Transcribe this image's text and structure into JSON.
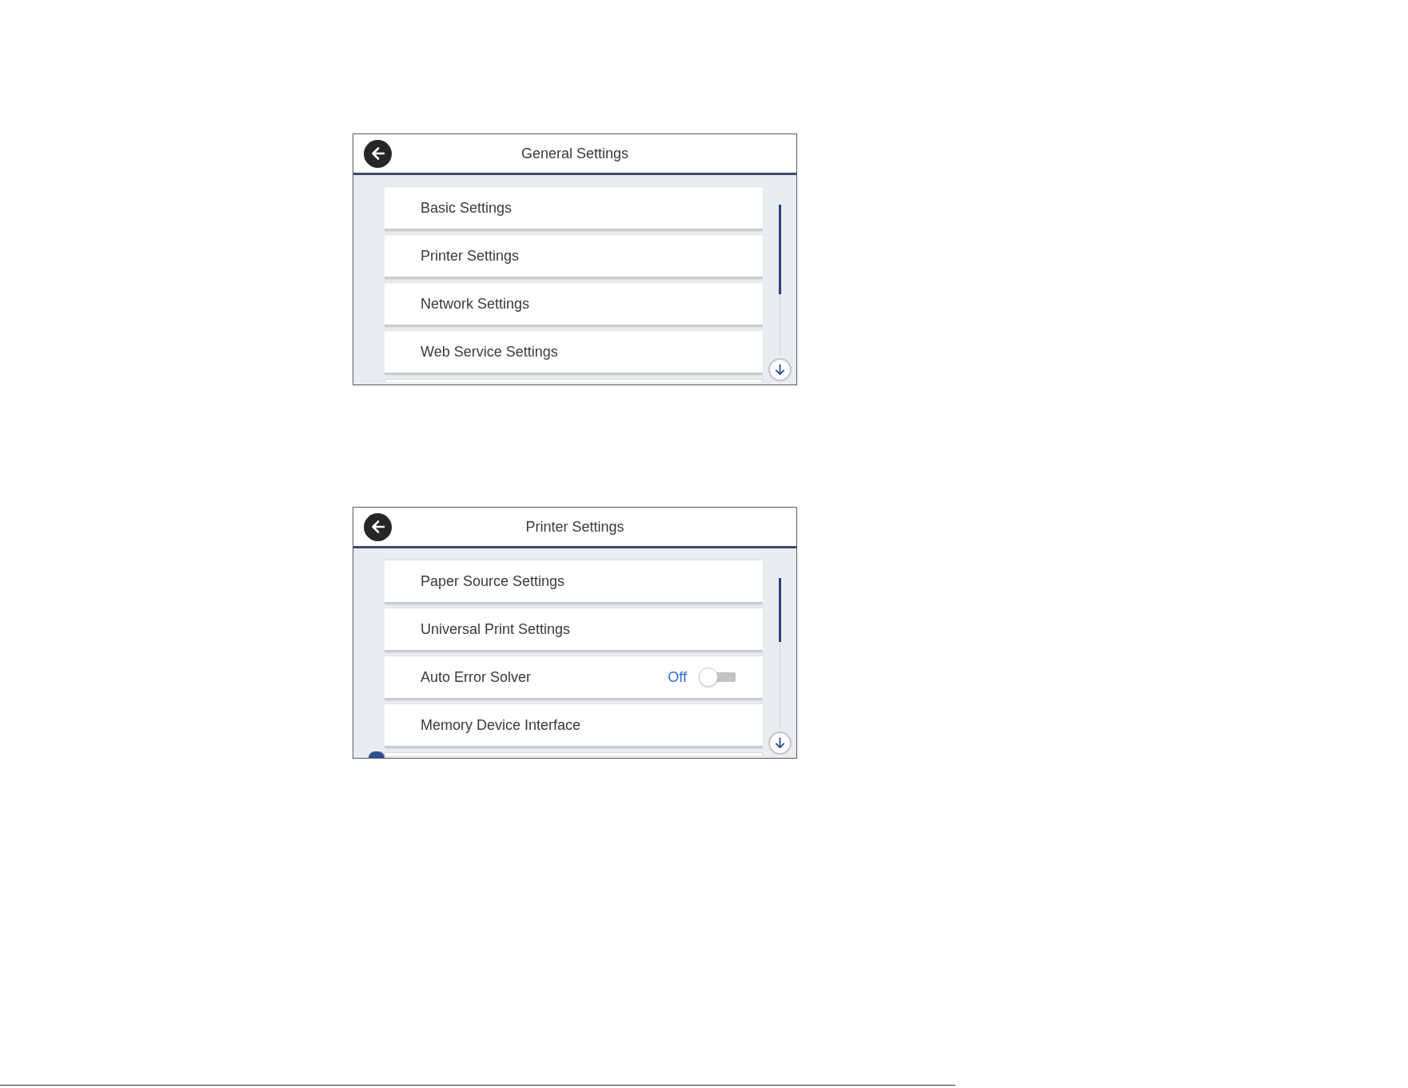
{
  "panels": [
    {
      "title": "General Settings",
      "items": [
        {
          "kind": "link",
          "label": "Basic Settings"
        },
        {
          "kind": "link",
          "label": "Printer Settings"
        },
        {
          "kind": "link",
          "label": "Network Settings"
        },
        {
          "kind": "link",
          "label": "Web Service Settings"
        }
      ]
    },
    {
      "title": "Printer Settings",
      "edge_icon": true,
      "items": [
        {
          "kind": "link",
          "label": "Paper Source Settings"
        },
        {
          "kind": "link",
          "label": "Universal Print Settings"
        },
        {
          "kind": "toggle",
          "label": "Auto Error Solver",
          "value": "Off",
          "on": false
        },
        {
          "kind": "link",
          "label": "Memory Device Interface"
        }
      ]
    }
  ]
}
